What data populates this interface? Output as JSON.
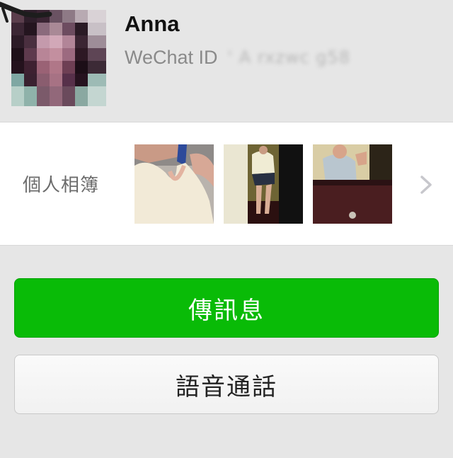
{
  "profile": {
    "name": "Anna",
    "wechat_label": "WeChat ID",
    "wechat_id": "' A rxzwc g58"
  },
  "album": {
    "label": "個人相簿",
    "photos": [
      "photo-1",
      "photo-2",
      "photo-3"
    ],
    "more_icon": "chevron-right-icon"
  },
  "actions": {
    "message": "傳訊息",
    "voice_call": "語音通話"
  },
  "colors": {
    "accent_green": "#09bb07",
    "background": "#e6e6e6"
  }
}
